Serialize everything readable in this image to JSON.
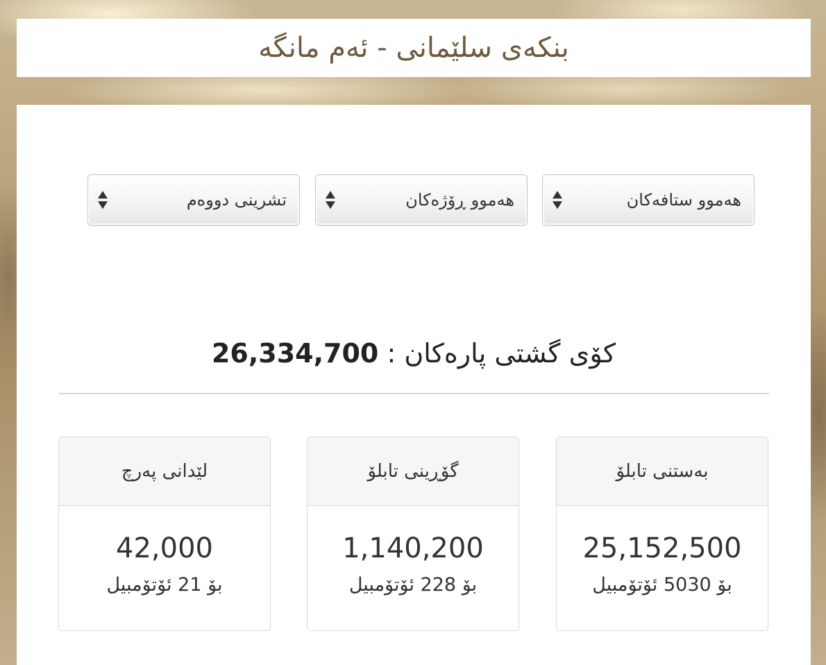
{
  "header": {
    "title": "بنکەی سلێمانی - ئەم مانگە"
  },
  "filters": {
    "staff": "هەموو ستافەکان",
    "days": "هەموو ڕۆژەکان",
    "month": "تشرینی دووەم"
  },
  "total": {
    "label": "کۆی گشتی پارەکان :",
    "value": "26,334,700"
  },
  "cards": [
    {
      "title": "بەستنی تابلۆ",
      "value": "25,152,500",
      "sub": "بۆ 5030 ئۆتۆمبیل"
    },
    {
      "title": "گۆڕینی تابلۆ",
      "value": "1,140,200",
      "sub": "بۆ 228 ئۆتۆمبیل"
    },
    {
      "title": "لێدانی پەرچ",
      "value": "42,000",
      "sub": "بۆ 21 ئۆتۆمبیل"
    }
  ]
}
